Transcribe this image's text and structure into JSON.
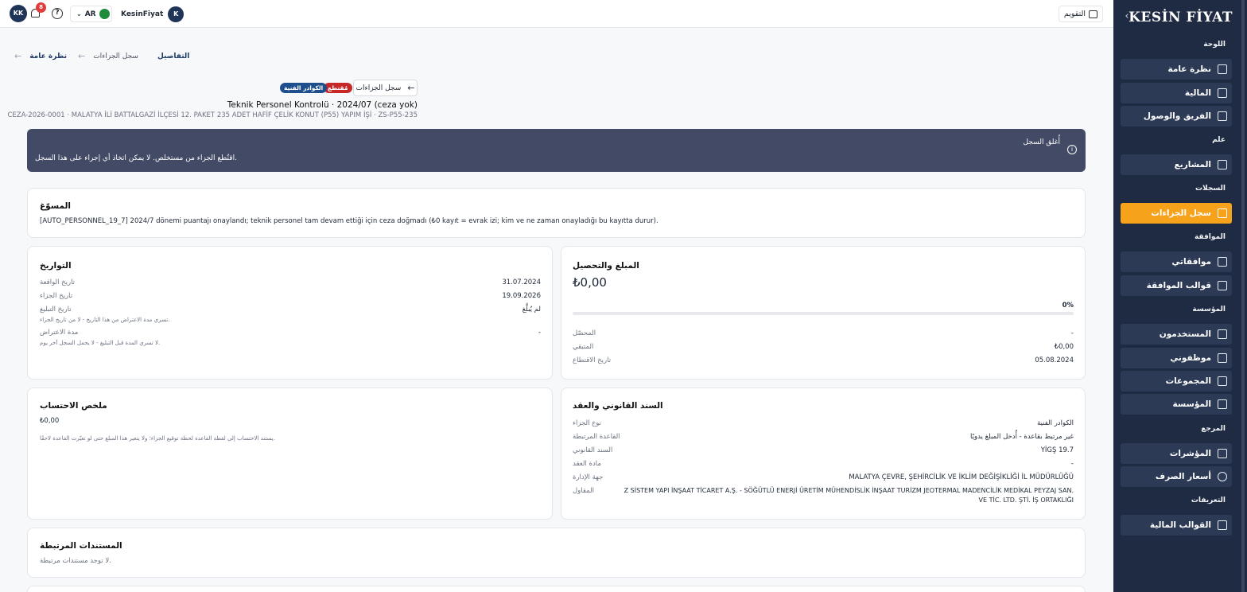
{
  "topbar": {
    "user_initials": "KK",
    "notification_count": "8",
    "language": "AR",
    "org_name": "KesinFiyat",
    "org_initial": "K",
    "calendar_label": "التقويم"
  },
  "sidebar": {
    "logo": "KESİN FİYAT",
    "sections": {
      "dashboard": "اللوحة",
      "general": "علم",
      "records": "السجلات",
      "approval": "الموافقة",
      "organization": "المؤسسة",
      "reference": "المرجع",
      "definitions": "التعريفات"
    },
    "items": {
      "overview": "نظرة عامة",
      "finance": "المالية",
      "team": "الفريق والوصول",
      "projects": "المشاريع",
      "penalties": "سجل الجزاءات",
      "my_approvals": "موافقاتي",
      "approval_templates": "قوالب الموافقة",
      "users": "المستخدمون",
      "employees": "موظفوني",
      "groups": "المجموعات",
      "institution": "المؤسسة",
      "indicators": "المؤشرات",
      "exchange_rates": "أسعار الصرف",
      "financial_templates": "القوالب المالية"
    }
  },
  "breadcrumb": {
    "overview": "نظرة عامة",
    "penalties": "سجل الجزاءات",
    "details": "التفاصيل"
  },
  "header": {
    "back_label": "سجل الجزاءات",
    "status_badge": "مُقتطع",
    "category_badge": "الكوادر الفنية",
    "title": "Teknik Personel Kontrolü · 2024/07 (ceza yok)",
    "subtitle": "CEZA-2026-0001 · MALATYA İLİ BATTALGAZİ İLÇESİ 12. PAKET 235 ADET HAFİF ÇELİK KONUT (P55) YAPIM İŞİ · ZS-P55-235"
  },
  "alert": {
    "title": "أُغلق السجل",
    "text": "اقتُطع الجزاء من مستخلص. لا يمكن اتخاذ أي إجراء على هذا السجل."
  },
  "justification": {
    "title": "المسوّغ",
    "text": "[AUTO_PERSONNEL_19_7] 2024/7 dönemi puantajı onaylandı; teknik personel tam devam ettiği için ceza doğmadı (₺0 kayıt = evrak izi; kim ve ne zaman onayladığı bu kayıtta durur)."
  },
  "dates": {
    "title": "التواريخ",
    "incident_label": "تاريخ الواقعة",
    "incident_value": "31.07.2024",
    "penalty_label": "تاريخ الجزاء",
    "penalty_value": "19.09.2026",
    "notice_label": "تاريخ التبليغ",
    "notice_value": "لم يُبلَّغ",
    "notice_hint": "تسري مدة الاعتراض من هذا التاريخ - لا من تاريخ الجزاء.",
    "objection_label": "مدة الاعتراض",
    "objection_value": "-",
    "objection_hint": "لا تسري المدة قبل التبليغ - لا يحمل السجل آخر يوم."
  },
  "amount": {
    "title": "المبلغ والتحصيل",
    "total": "₺0,00",
    "percent_label": "0%",
    "percent": 0,
    "collected_label": "المحصّل",
    "collected_value": "-",
    "remaining_label": "المتبقي",
    "remaining_value": "₺0,00",
    "deduction_label": "تاريخ الاقتطاع",
    "deduction_value": "05.08.2024"
  },
  "calc": {
    "title": "ملخص الاحتساب",
    "value": "₺0,00",
    "note": "يستند الاحتساب إلى لقطة القاعدة لحظة توقيع الجزاء؛ ولا يتغير هذا المبلغ حتى لو تغيّرت القاعدة لاحقًا."
  },
  "legal": {
    "title": "السند القانوني والعقد",
    "type_label": "نوع الجزاء",
    "type_value": "الكوادر الفنية",
    "rule_label": "القاعدة المرتبطة",
    "rule_value": "غير مرتبط بقاعدة - أُدخل المبلغ يدويًا",
    "basis_label": "السند القانوني",
    "basis_value": "YİGŞ 19.7",
    "article_label": "مادة العقد",
    "article_value": "-",
    "authority_label": "جهة الإدارة",
    "authority_value": "MALATYA ÇEVRE, ŞEHİRCİLİK VE İKLİM DEĞİŞİKLİĞİ İL MÜDÜRLÜĞÜ",
    "contractor_label": "المقاول",
    "contractor_line1": "Z SİSTEM YAPI İNŞAAT TİCARET A.Ş. - SÖĞÜTLÜ ENERJİ ÜRETİM MÜHENDİSLİK İNŞAAT TURİZM JEOTERMAL MADENCİLİK MEDİKAL PEYZAJ SAN.",
    "contractor_line2": "VE TİC. LTD. ŞTİ. İŞ ORTAKLIĞI"
  },
  "documents": {
    "title": "المستندات المرتبطة",
    "empty": "لا توجد مستندات مرتبطة."
  },
  "colors": {
    "sidebar_bg": "#1f2b42",
    "active_item": "#f7a21b",
    "alert_bg": "#434a65",
    "badge_red": "#c62828",
    "badge_blue": "#1e4e8c"
  },
  "icons": {
    "back": "arrow-left-icon",
    "breadcrumb_separator": "arrow-left-icon",
    "alert": "info-icon",
    "notifications": "bell-icon",
    "help": "question-icon",
    "calendar": "calendar-icon",
    "collapse": "chevron-left-icon"
  }
}
